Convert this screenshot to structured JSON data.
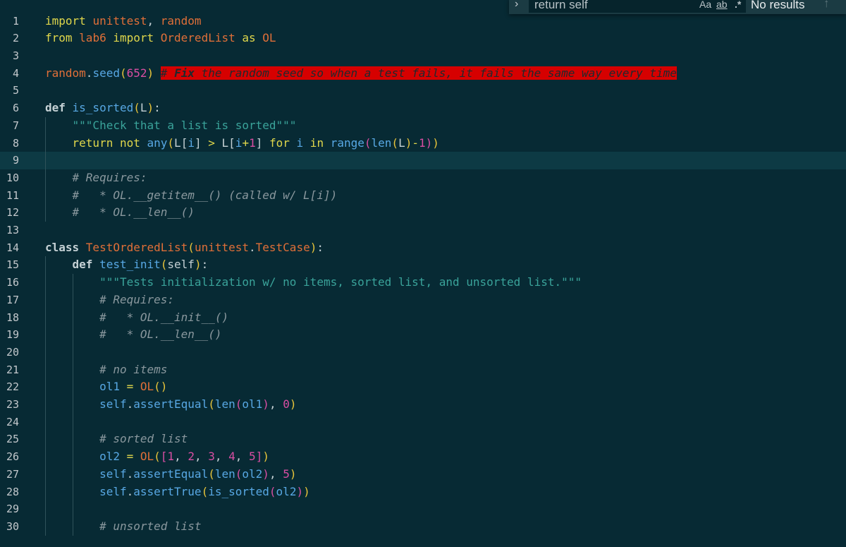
{
  "find_widget": {
    "query": "return self",
    "match_case_label": "Aa",
    "whole_word_label": "ab",
    "regex_label": ".*",
    "results_label": "No results",
    "toggle_icon": "chevron-right-icon",
    "prev_icon": "arrow-up-icon"
  },
  "editor": {
    "current_line": 9,
    "lines": [
      {
        "n": "1",
        "code": [
          [
            "kw",
            "import "
          ],
          [
            "mod",
            "unittest"
          ],
          [
            "op",
            ", "
          ],
          [
            "mod",
            "random"
          ]
        ]
      },
      {
        "n": "2",
        "code": [
          [
            "kw",
            "from "
          ],
          [
            "mod",
            "lab6"
          ],
          [
            "kw",
            " import "
          ],
          [
            "mod",
            "OrderedList"
          ],
          [
            "kw",
            " as "
          ],
          [
            "mod",
            "OL"
          ]
        ]
      },
      {
        "n": "3",
        "code": []
      },
      {
        "n": "4",
        "code": [
          [
            "mod",
            "random"
          ],
          [
            "op",
            "."
          ],
          [
            "fn",
            "seed"
          ],
          [
            "p",
            "("
          ],
          [
            "num",
            "652"
          ],
          [
            "p",
            ")"
          ],
          [
            "op",
            " "
          ],
          [
            "hl",
            "# Fix the random seed so when a test fails, it fails the same way every time"
          ]
        ]
      },
      {
        "n": "5",
        "code": []
      },
      {
        "n": "6",
        "code": [
          [
            "kwb",
            "def "
          ],
          [
            "fn",
            "is_sorted"
          ],
          [
            "p",
            "("
          ],
          [
            "op",
            "L"
          ],
          [
            "p",
            ")"
          ],
          [
            "op",
            ":"
          ]
        ]
      },
      {
        "n": "7",
        "code": [
          [
            "op",
            "    "
          ],
          [
            "str",
            "\"\"\"Check that a list is sorted\"\"\""
          ]
        ]
      },
      {
        "n": "8",
        "code": [
          [
            "op",
            "    "
          ],
          [
            "kw",
            "return not "
          ],
          [
            "fn",
            "any"
          ],
          [
            "p",
            "("
          ],
          [
            "op",
            "L"
          ],
          [
            "p2",
            "["
          ],
          [
            "fn",
            "i"
          ],
          [
            "p2",
            "]"
          ],
          [
            "kw",
            " > "
          ],
          [
            "op",
            "L"
          ],
          [
            "p2",
            "["
          ],
          [
            "fn",
            "i"
          ],
          [
            "kw",
            "+"
          ],
          [
            "num",
            "1"
          ],
          [
            "p2",
            "]"
          ],
          [
            "kw",
            " for "
          ],
          [
            "fn",
            "i"
          ],
          [
            "kw",
            " in "
          ],
          [
            "fn",
            "range"
          ],
          [
            "num",
            "("
          ],
          [
            "fn",
            "len"
          ],
          [
            "t-p",
            "("
          ],
          [
            "op",
            "L"
          ],
          [
            "t-p",
            ")"
          ],
          [
            "kw",
            "-"
          ],
          [
            "num",
            "1)"
          ],
          [
            "p",
            ")"
          ]
        ]
      },
      {
        "n": "9",
        "code": []
      },
      {
        "n": "10",
        "code": [
          [
            "op",
            "    "
          ],
          [
            "cm",
            "# Requires:"
          ]
        ]
      },
      {
        "n": "11",
        "code": [
          [
            "op",
            "    "
          ],
          [
            "cm",
            "#   * OL.__getitem__() (called w/ L[i])"
          ]
        ]
      },
      {
        "n": "12",
        "code": [
          [
            "op",
            "    "
          ],
          [
            "cm",
            "#   * OL.__len__()"
          ]
        ]
      },
      {
        "n": "13",
        "code": []
      },
      {
        "n": "14",
        "code": [
          [
            "kwb",
            "class "
          ],
          [
            "cls",
            "TestOrderedList"
          ],
          [
            "p",
            "("
          ],
          [
            "mod",
            "unittest"
          ],
          [
            "op",
            "."
          ],
          [
            "cls",
            "TestCase"
          ],
          [
            "p",
            ")"
          ],
          [
            "op",
            ":"
          ]
        ]
      },
      {
        "n": "15",
        "code": [
          [
            "op",
            "    "
          ],
          [
            "kwb",
            "def "
          ],
          [
            "fn",
            "test_init"
          ],
          [
            "p",
            "("
          ],
          [
            "op",
            "self"
          ],
          [
            "p",
            ")"
          ],
          [
            "op",
            ":"
          ]
        ]
      },
      {
        "n": "16",
        "code": [
          [
            "op",
            "        "
          ],
          [
            "str",
            "\"\"\"Tests initialization w/ no items, sorted list, and unsorted list.\"\"\""
          ]
        ]
      },
      {
        "n": "17",
        "code": [
          [
            "op",
            "        "
          ],
          [
            "cm",
            "# Requires:"
          ]
        ]
      },
      {
        "n": "18",
        "code": [
          [
            "op",
            "        "
          ],
          [
            "cm",
            "#   * OL.__init__()"
          ]
        ]
      },
      {
        "n": "19",
        "code": [
          [
            "op",
            "        "
          ],
          [
            "cm",
            "#   * OL.__len__()"
          ]
        ]
      },
      {
        "n": "20",
        "code": []
      },
      {
        "n": "21",
        "code": [
          [
            "op",
            "        "
          ],
          [
            "cm",
            "# no items"
          ]
        ]
      },
      {
        "n": "22",
        "code": [
          [
            "op",
            "        "
          ],
          [
            "fn",
            "ol1"
          ],
          [
            "kw",
            " = "
          ],
          [
            "mod",
            "OL"
          ],
          [
            "p",
            "()"
          ]
        ]
      },
      {
        "n": "23",
        "code": [
          [
            "op",
            "        "
          ],
          [
            "fn",
            "self"
          ],
          [
            "op",
            "."
          ],
          [
            "fn",
            "assertEqual"
          ],
          [
            "p",
            "("
          ],
          [
            "fn",
            "len"
          ],
          [
            "num",
            "("
          ],
          [
            "fn",
            "ol1"
          ],
          [
            "num",
            ")"
          ],
          [
            "op",
            ", "
          ],
          [
            "num",
            "0"
          ],
          [
            "p",
            ")"
          ]
        ]
      },
      {
        "n": "24",
        "code": []
      },
      {
        "n": "25",
        "code": [
          [
            "op",
            "        "
          ],
          [
            "cm",
            "# sorted list"
          ]
        ]
      },
      {
        "n": "26",
        "code": [
          [
            "op",
            "        "
          ],
          [
            "fn",
            "ol2"
          ],
          [
            "kw",
            " = "
          ],
          [
            "mod",
            "OL"
          ],
          [
            "p",
            "("
          ],
          [
            "num",
            "["
          ],
          [
            "num",
            "1"
          ],
          [
            "op",
            ", "
          ],
          [
            "num",
            "2"
          ],
          [
            "op",
            ", "
          ],
          [
            "num",
            "3"
          ],
          [
            "op",
            ", "
          ],
          [
            "num",
            "4"
          ],
          [
            "op",
            ", "
          ],
          [
            "num",
            "5"
          ],
          [
            "num",
            "]"
          ],
          [
            "p",
            ")"
          ]
        ]
      },
      {
        "n": "27",
        "code": [
          [
            "op",
            "        "
          ],
          [
            "fn",
            "self"
          ],
          [
            "op",
            "."
          ],
          [
            "fn",
            "assertEqual"
          ],
          [
            "p",
            "("
          ],
          [
            "fn",
            "len"
          ],
          [
            "num",
            "("
          ],
          [
            "fn",
            "ol2"
          ],
          [
            "num",
            ")"
          ],
          [
            "op",
            ", "
          ],
          [
            "num",
            "5"
          ],
          [
            "p",
            ")"
          ]
        ]
      },
      {
        "n": "28",
        "code": [
          [
            "op",
            "        "
          ],
          [
            "fn",
            "self"
          ],
          [
            "op",
            "."
          ],
          [
            "fn",
            "assertTrue"
          ],
          [
            "p",
            "("
          ],
          [
            "fn",
            "is_sorted"
          ],
          [
            "num",
            "("
          ],
          [
            "fn",
            "ol2"
          ],
          [
            "num",
            ")"
          ],
          [
            "p",
            ")"
          ]
        ]
      },
      {
        "n": "29",
        "code": []
      },
      {
        "n": "30",
        "code": [
          [
            "op",
            "        "
          ],
          [
            "cm",
            "# unsorted list"
          ]
        ]
      }
    ]
  }
}
